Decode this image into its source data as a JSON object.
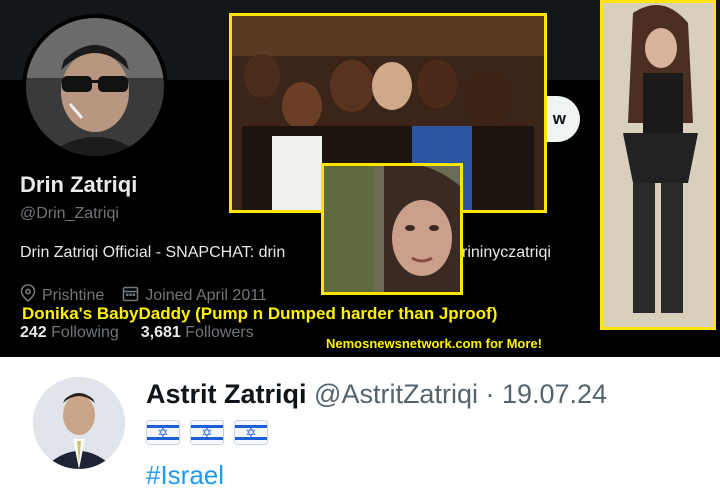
{
  "profile": {
    "display_name": "Drin Zatriqi",
    "handle": "@Drin_Zatriqi",
    "bio": "Drin Zatriqi Official - SNAPCHAT: drin",
    "bio_tail": "rininyczatriqi",
    "location": "Prishtine",
    "joined": "Joined April 2011",
    "following_count": "242",
    "following_label": "Following",
    "followers_count": "3,681",
    "followers_label": "Followers",
    "follow_button_tail": "w"
  },
  "overlay": {
    "caption": "Donika's BabyDaddy (Pump n Dumped harder than Jproof)",
    "watermark": "Nemosnewsnetwork.com for More!"
  },
  "tweet": {
    "display_name": "Astrit Zatriqi",
    "handle_date": "@AstritZatriqi · 19.07.24",
    "hashtag": "#Israel",
    "flags": [
      "israel-flag-icon",
      "israel-flag-icon",
      "israel-flag-icon"
    ]
  },
  "colors": {
    "overlay_accent": "#ffe500",
    "link": "#1d9bf0",
    "dark_bg": "#000000"
  }
}
